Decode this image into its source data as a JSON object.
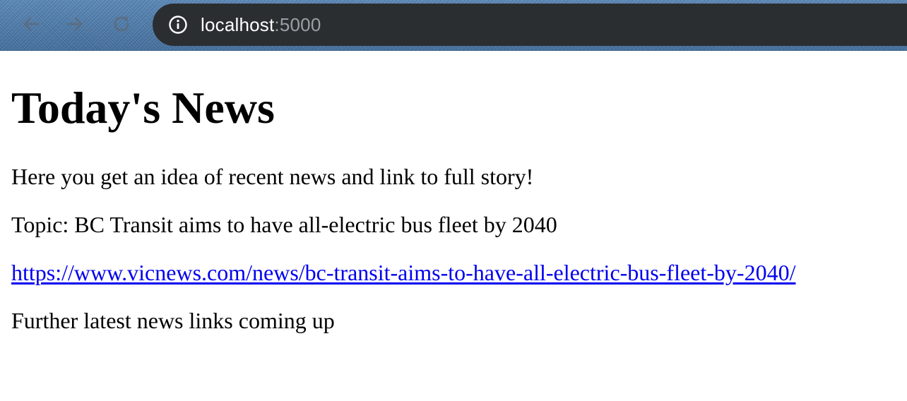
{
  "browser": {
    "url_host": "localhost",
    "url_port": ":5000",
    "icons": {
      "back": "arrow-left-icon",
      "forward": "arrow-right-icon",
      "reload": "reload-icon",
      "info": "info-icon"
    }
  },
  "page": {
    "heading": "Today's News",
    "intro": "Here you get an idea of recent news and link to full story!",
    "topic": "Topic: BC Transit aims to have all-electric bus fleet by 2040",
    "link_url": "https://www.vicnews.com/news/bc-transit-aims-to-have-all-electric-bus-fleet-by-2040/",
    "link_text": "https://www.vicnews.com/news/bc-transit-aims-to-have-all-electric-bus-fleet-by-2040/",
    "footer_note": "Further latest news links coming up"
  },
  "colors": {
    "link": "#0000ee",
    "omnibox_bg": "#2b2e31",
    "url_port": "#9aa0a6"
  }
}
